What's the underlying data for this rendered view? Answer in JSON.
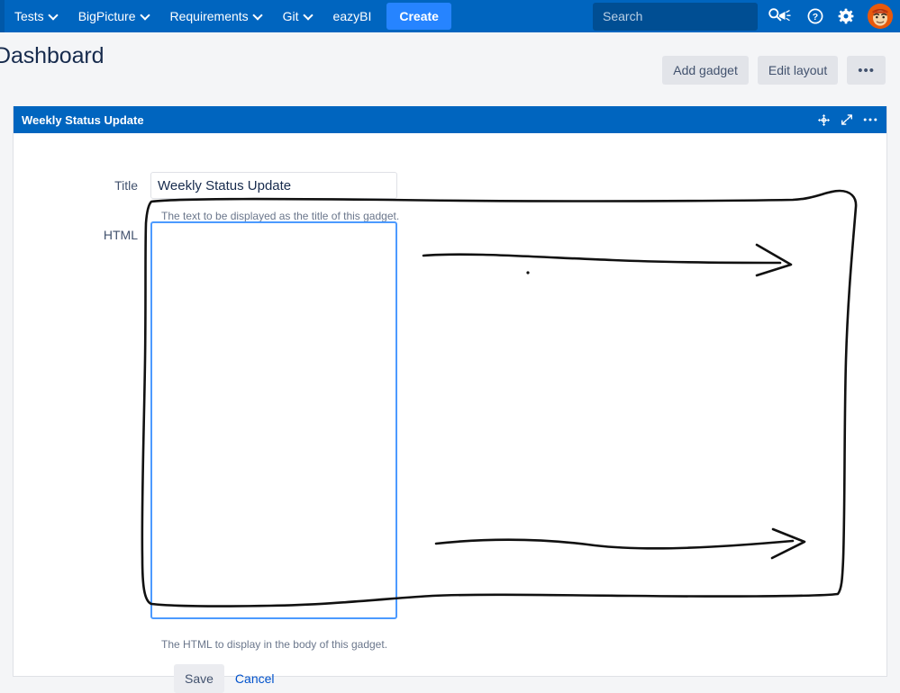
{
  "nav": {
    "menu_toggle_icon": "chevron-down-icon",
    "items": [
      {
        "label": "Tests",
        "has_caret": true
      },
      {
        "label": "BigPicture",
        "has_caret": true
      },
      {
        "label": "Requirements",
        "has_caret": true
      },
      {
        "label": "Git",
        "has_caret": true
      },
      {
        "label": "eazyBI",
        "has_caret": false
      }
    ],
    "create_label": "Create",
    "search_placeholder": "Search",
    "search_value": "",
    "search_icon": "search-icon",
    "icons": [
      {
        "name": "announcements-icon",
        "glyph": "megaphone"
      },
      {
        "name": "help-icon",
        "glyph": "question-circle"
      },
      {
        "name": "settings-icon",
        "glyph": "gear"
      }
    ],
    "avatar_name": "user-avatar",
    "background_color": "#0065BF",
    "create_color": "#2684FF",
    "search_background": "#004E93"
  },
  "header": {
    "title": "Dashboard",
    "add_gadget_label": "Add gadget",
    "edit_layout_label": "Edit layout",
    "more_label": "•••"
  },
  "gadget": {
    "title": "Weekly Status Update",
    "titlebar_color": "#0065BF",
    "titlebar_icons": [
      {
        "name": "move-handle-icon",
        "glyph": "four-way-arrow"
      },
      {
        "name": "maximize-icon",
        "glyph": "diagonal-arrows"
      },
      {
        "name": "gadget-menu-icon",
        "glyph": "ellipsis"
      }
    ],
    "form": {
      "title_field": {
        "label": "Title",
        "value": "Weekly Status Update",
        "description": "The text to be displayed as the title of this gadget."
      },
      "html_field": {
        "label": "HTML",
        "value": "",
        "description": "The HTML to display in the body of this gadget.",
        "focused": true,
        "focus_color": "#4C9AFF"
      },
      "save_label": "Save",
      "cancel_label": "Cancel"
    }
  },
  "annotation": {
    "type": "hand-drawn-ink",
    "color": "#111111",
    "shapes": [
      {
        "name": "highlight-rectangle",
        "description": "freehand rectangle surrounding HTML field and area to its right"
      },
      {
        "name": "arrow-upper",
        "description": "freehand arrow pointing right"
      },
      {
        "name": "arrow-lower",
        "description": "freehand arrow pointing right"
      },
      {
        "name": "ink-dot",
        "description": "small stray dot"
      }
    ]
  }
}
